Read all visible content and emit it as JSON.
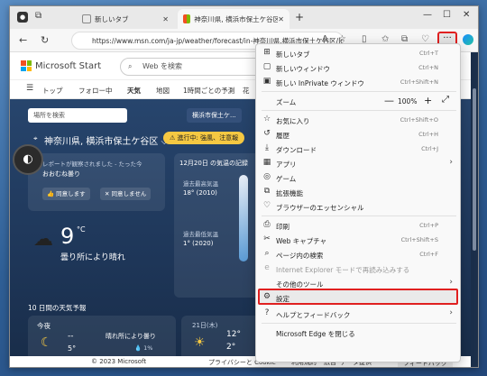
{
  "browser": {
    "tabs": [
      {
        "title": "新しいタブ",
        "active": false
      },
      {
        "title": "神奈川県, 横浜市保土ケ谷区 の天",
        "active": true
      }
    ],
    "new_tab": "+",
    "address": "https://www.msn.com/ja-jp/weather/forecast/in-神奈川県,横浜市保土ケ谷区/loc...",
    "more_button": "···",
    "window_controls": {
      "minimize": "—",
      "maximize": "☐",
      "close": "✕"
    }
  },
  "site": {
    "brand": "Microsoft Start",
    "search_placeholder": "Web を検索",
    "nav": [
      "トップ",
      "フォロー中",
      "天気",
      "地図",
      "1時間ごとの予測",
      "花"
    ],
    "location_input_placeholder": "場所を検索",
    "location_chip": "横浜市保土ケ...",
    "location_title": "神奈川県, 横浜市保土ケ谷区 ⌵",
    "alert": "⚠ 進行中: 強風、注意報",
    "report": "レポートが観察されました - たった今",
    "condition_small": "おおむね曇り",
    "agree": "👍 同意します",
    "disagree": "✕ 同意しません",
    "temperature": "9",
    "unit": "°C",
    "condition": "曇り所により晴れ",
    "record_title": "12月20日 の気温の記録",
    "record_high_label": "過去最高気温",
    "record_high_value": "18° (2010)",
    "record_low_label": "過去最低気温",
    "record_low_value": "1° (2020)",
    "forecast_title": "10 日間の天気予報",
    "today_label": "今夜",
    "today_high": "--",
    "today_low": "5°",
    "today_desc": "晴れ所により曇り",
    "today_precip": "💧 1%",
    "day2_label": "21日(木)",
    "day2_high": "12°",
    "day2_low": "2°",
    "footer_copyright": "© 2023 Microsoft",
    "footer_links": [
      "プライバシーと Cookie",
      "利用規約",
      "広告",
      "データ提供"
    ],
    "feedback": "フィードバック"
  },
  "menu": {
    "items": [
      {
        "icon": "⊞",
        "label": "新しいタブ",
        "shortcut": "Ctrl+T"
      },
      {
        "icon": "▢",
        "label": "新しいウィンドウ",
        "shortcut": "Ctrl+N"
      },
      {
        "icon": "▣",
        "label": "新しい InPrivate ウィンドウ",
        "shortcut": "Ctrl+Shift+N"
      },
      {
        "icon": "",
        "label": "ズーム",
        "shortcut": ""
      },
      {
        "icon": "☆",
        "label": "お気に入り",
        "shortcut": "Ctrl+Shift+O"
      },
      {
        "icon": "↺",
        "label": "履歴",
        "shortcut": "Ctrl+H"
      },
      {
        "icon": "⤓",
        "label": "ダウンロード",
        "shortcut": "Ctrl+J"
      },
      {
        "icon": "▦",
        "label": "アプリ",
        "shortcut": ""
      },
      {
        "icon": "◎",
        "label": "ゲーム",
        "shortcut": ""
      },
      {
        "icon": "⧉",
        "label": "拡張機能",
        "shortcut": ""
      },
      {
        "icon": "♡",
        "label": "ブラウザーのエッセンシャル",
        "shortcut": ""
      },
      {
        "icon": "⎙",
        "label": "印刷",
        "shortcut": "Ctrl+P"
      },
      {
        "icon": "✂",
        "label": "Web キャプチャ",
        "shortcut": "Ctrl+Shift+S"
      },
      {
        "icon": "⌕",
        "label": "ページ内の検索",
        "shortcut": "Ctrl+F"
      },
      {
        "icon": "",
        "label": "Internet Explorer モードで再読み込みする",
        "shortcut": ""
      },
      {
        "icon": "",
        "label": "その他のツール",
        "shortcut": ""
      },
      {
        "icon": "⚙",
        "label": "設定",
        "shortcut": ""
      },
      {
        "icon": "?",
        "label": "ヘルプとフィードバック",
        "shortcut": ""
      },
      {
        "icon": "",
        "label": "Microsoft Edge を閉じる",
        "shortcut": ""
      }
    ],
    "zoom_value": "100%",
    "zoom_minus": "—",
    "zoom_plus": "+",
    "fullscreen": "⤢"
  },
  "colors": {
    "highlight": "#e02020",
    "accent": "#0067b8",
    "alert": "#f5c842"
  }
}
